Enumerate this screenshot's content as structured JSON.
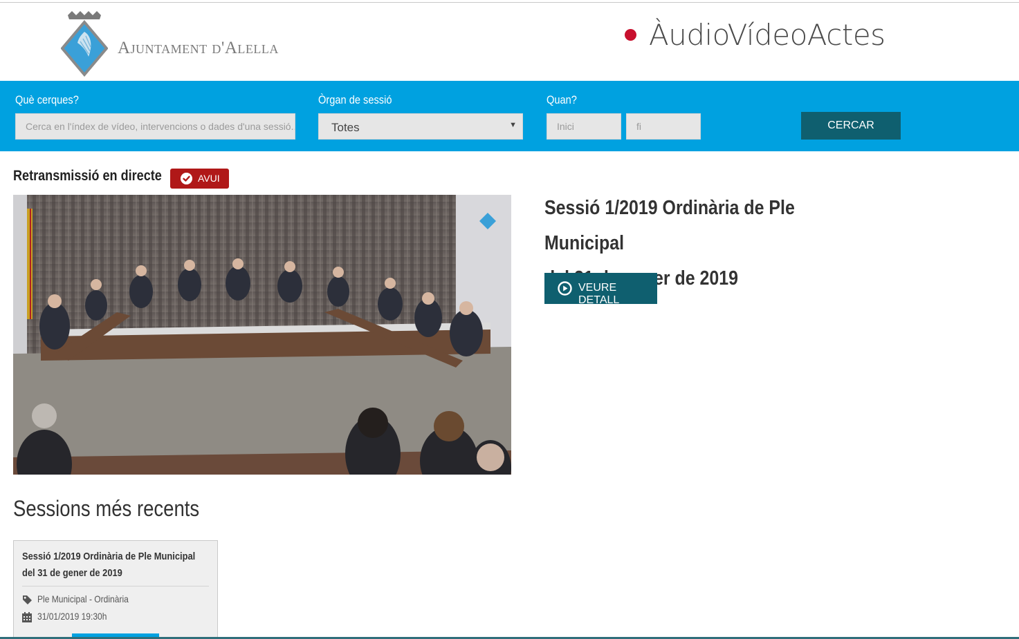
{
  "header": {
    "brand": "Ajuntament d'Alella",
    "app_title": "ÀudioVídeoActes",
    "colors": {
      "record_dot": "#c8102e",
      "crest": "#3aa0d8"
    }
  },
  "search": {
    "query_label": "Què cerques?",
    "query_placeholder": "Cerca en l'índex de vídeo, intervencions o dades d'una sessió....",
    "organ_label": "Òrgan de sessió",
    "organ_value": "Totes",
    "when_label": "Quan?",
    "start_placeholder": "Inici",
    "end_placeholder": "fi",
    "submit_label": "CERCAR",
    "colors": {
      "bar": "#00a1e0",
      "button": "#0f5f6f"
    }
  },
  "live": {
    "heading": "Retransmissió en directe",
    "badge": "AVUI",
    "badge_icon": "check-circle-icon",
    "session_title_line1": "Sessió 1/2019 Ordinària de Ple Municipal",
    "session_title_line2": "del 31 de gener de 2019",
    "detail_button": "VEURE DETALL",
    "detail_icon": "play-circle-icon",
    "colors": {
      "badge": "#b01818"
    }
  },
  "recent": {
    "heading": "Sessions més recents",
    "cards": [
      {
        "title_line1": "Sessió 1/2019 Ordinària de Ple Municipal",
        "title_line2": "del 31 de gener de 2019",
        "organ": "Ple Municipal - Ordinària",
        "organ_icon": "tag-icon",
        "datetime": "31/01/2019 19:30h",
        "datetime_icon": "calendar-icon"
      }
    ]
  }
}
